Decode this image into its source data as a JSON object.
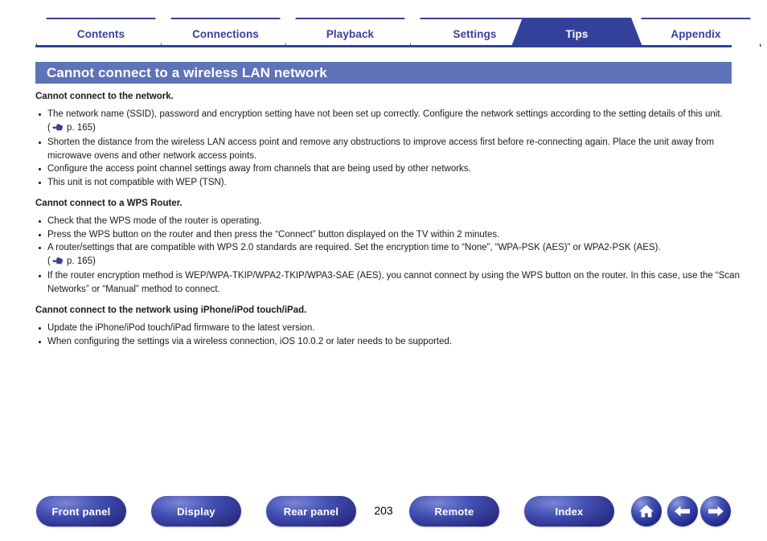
{
  "tabs": [
    {
      "label": "Contents",
      "active": false
    },
    {
      "label": "Connections",
      "active": false
    },
    {
      "label": "Playback",
      "active": false
    },
    {
      "label": "Settings",
      "active": false
    },
    {
      "label": "Tips",
      "active": true
    },
    {
      "label": "Appendix",
      "active": false
    }
  ],
  "page": {
    "title": "Cannot connect to a wireless LAN network",
    "title_bar_color": "#5e73b8",
    "accent_color": "#33419c",
    "number": "203"
  },
  "sections": [
    {
      "heading": "Cannot connect to the network.",
      "items": [
        {
          "text": "The network name (SSID), password and encryption setting have not been set up correctly. Configure the network settings according to the setting details of this unit.",
          "ref": "p. 165",
          "ref_icon": "pointing-hand-icon"
        },
        {
          "text": "Shorten the distance from the wireless LAN access point and remove any obstructions to improve access first before re-connecting again. Place the unit away from microwave ovens and other network access points.",
          "ref": "",
          "ref_icon": ""
        },
        {
          "text": "Configure the access point channel settings away from channels that are being used by other networks.",
          "ref": "",
          "ref_icon": ""
        },
        {
          "text": "This unit is not compatible with WEP (TSN).",
          "ref": "",
          "ref_icon": ""
        }
      ]
    },
    {
      "heading": "Cannot connect to a WPS Router.",
      "items": [
        {
          "text": "Check that the WPS mode of the router is operating.",
          "ref": "",
          "ref_icon": ""
        },
        {
          "text": "Press the WPS button on the router and then press the “Connect” button displayed on the TV within 2 minutes.",
          "ref": "",
          "ref_icon": ""
        },
        {
          "text": "A router/settings that are compatible with WPS 2.0 standards are required. Set the encryption time to “None”, “WPA-PSK (AES)” or WPA2-PSK (AES).",
          "ref": "p. 165",
          "ref_icon": "pointing-hand-icon",
          "ref_on_new_line": true
        },
        {
          "text": "If the router encryption method is WEP/WPA-TKIP/WPA2-TKIP/WPA3-SAE (AES), you cannot connect by using the WPS button on the router. In this case, use the “Scan Networks” or “Manual” method to connect.",
          "ref": "",
          "ref_icon": ""
        }
      ]
    },
    {
      "heading": "Cannot connect to the network using iPhone/iPod touch/iPad.",
      "items": [
        {
          "text": "Update the iPhone/iPod touch/iPad firmware to the latest version.",
          "ref": "",
          "ref_icon": ""
        },
        {
          "text": "When configuring the settings via a wireless connection, iOS 10.0.2 or later needs to be supported.",
          "ref": "",
          "ref_icon": ""
        }
      ]
    }
  ],
  "bottom_nav": {
    "buttons": [
      {
        "label": "Front panel"
      },
      {
        "label": "Display"
      },
      {
        "label": "Rear panel"
      },
      {
        "label": "Remote"
      },
      {
        "label": "Index"
      }
    ],
    "icon_buttons": [
      {
        "name": "home-icon"
      },
      {
        "name": "back-arrow-icon"
      },
      {
        "name": "forward-arrow-icon"
      }
    ]
  }
}
